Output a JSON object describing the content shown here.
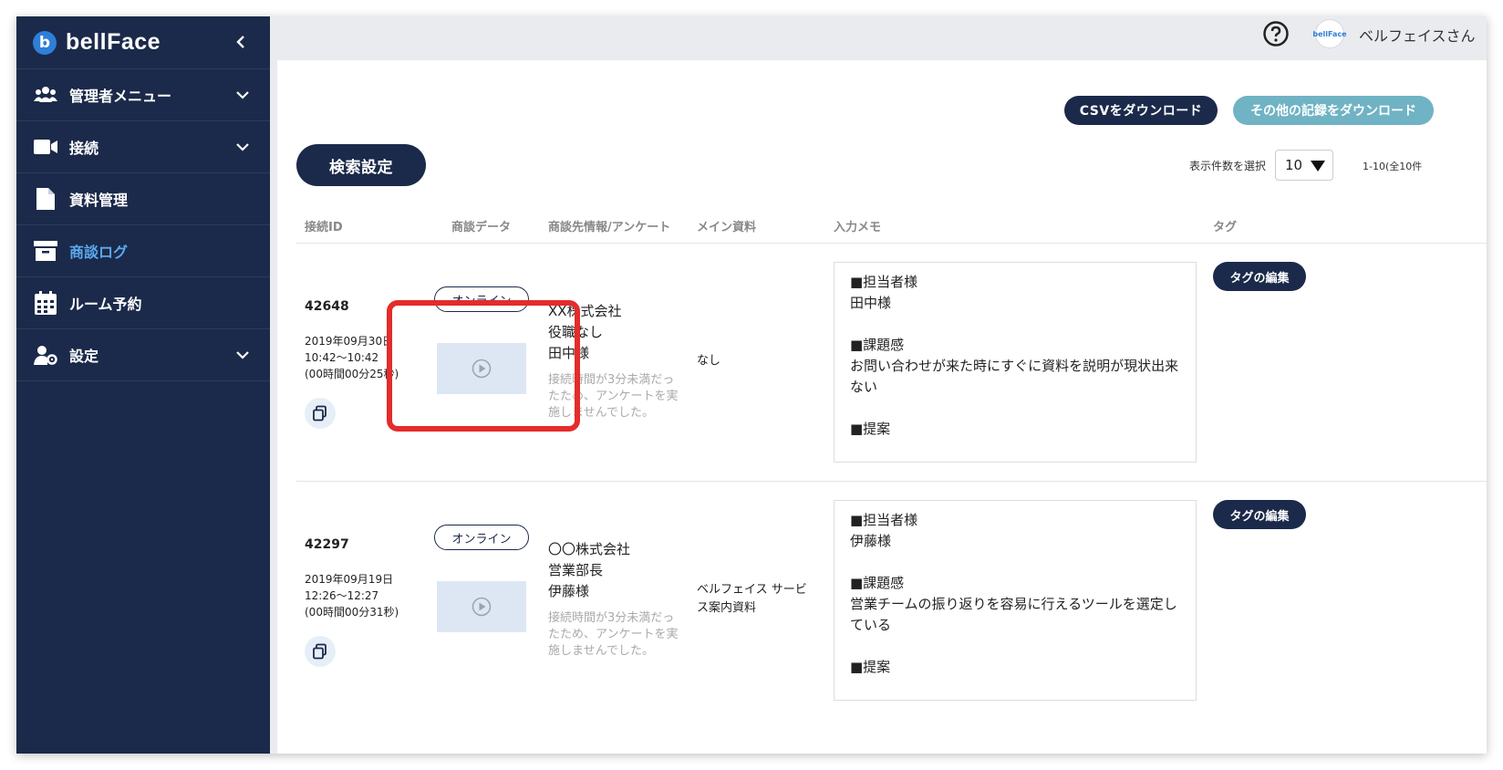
{
  "brand": {
    "logo_letter": "b",
    "name": "bellFace"
  },
  "sidebar": {
    "items": [
      {
        "label": "管理者メニュー",
        "icon": "users-icon",
        "expandable": true
      },
      {
        "label": "接続",
        "icon": "video-icon",
        "expandable": true
      },
      {
        "label": "資料管理",
        "icon": "document-icon",
        "expandable": false
      },
      {
        "label": "商談ログ",
        "icon": "archive-icon",
        "expandable": false,
        "active": true
      },
      {
        "label": "ルーム予約",
        "icon": "calendar-icon",
        "expandable": false
      },
      {
        "label": "設定",
        "icon": "user-settings-icon",
        "expandable": true
      }
    ]
  },
  "header": {
    "avatar_text": "bellFace",
    "user_name": "ベルフェイスさん"
  },
  "toolbar": {
    "csv_download_label": "CSVをダウンロード",
    "other_download_label": "その他の記録をダウンロード",
    "search_settings_label": "検索設定",
    "per_page_label": "表示件数を選択",
    "per_page_value": "10",
    "range_text": "1-10(全10件"
  },
  "table": {
    "columns": [
      "接続ID",
      "商談データ",
      "商談先情報/アンケート",
      "メイン資料",
      "入力メモ",
      "タグ"
    ],
    "rows": [
      {
        "id": "42648",
        "time": "2019年09月30日\n10:42〜10:42\n(00時間00分25秒)",
        "badge": "オンライン",
        "company": "XX株式会社\n役職なし\n田中様",
        "survey_note": "接続時間が3分未満だったため、アンケートを実施しませんでした。",
        "main_doc": "なし",
        "memo": "■担当者様\n田中様\n\n■課題感\nお問い合わせが来た時にすぐに資料を説明が現状出来ない\n\n■提案",
        "tag_button": "タグの編集"
      },
      {
        "id": "42297",
        "time": "2019年09月19日\n12:26〜12:27\n(00時間00分31秒)",
        "badge": "オンライン",
        "company": "〇〇株式会社\n営業部長\n伊藤様",
        "survey_note": "接続時間が3分未満だったため、アンケートを実施しませんでした。",
        "main_doc": "ベルフェイス サービス案内資料",
        "memo": "■担当者様\n伊藤様\n\n■課題感\n営業チームの振り返りを容易に行えるツールを選定している\n\n■提案",
        "tag_button": "タグの編集"
      }
    ]
  },
  "colors": {
    "sidebar": "#1b2a4a",
    "accent": "#5aa9f0",
    "highlight": "#e52b2b"
  }
}
